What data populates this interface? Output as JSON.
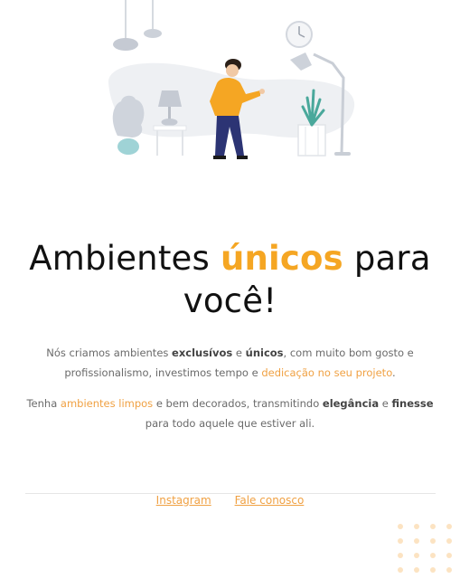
{
  "hero": {
    "title_part1": "Ambientes ",
    "title_accent": "únicos",
    "title_part2": " para",
    "title_line2": "você!"
  },
  "paragraph1": {
    "t1": "Nós criamos ambientes ",
    "b1": "exclusívos",
    "t2": " e ",
    "b2": "únicos",
    "t3": ", com muito bom gosto e profissionalismo, investimos tempo e ",
    "accent1": "dedicação no seu projeto",
    "t4": "."
  },
  "paragraph2": {
    "t1": "Tenha ",
    "accent1": "ambientes limpos",
    "t2": " e bem decorados, transmitindo ",
    "b1": "elegância",
    "t3": " e ",
    "b2": "finesse",
    "t4": " para todo aquele que estiver ali."
  },
  "footer": {
    "instagram_label": "Instagram",
    "contact_label": "Fale conosco"
  },
  "colors": {
    "accent": "#F5A623",
    "link": "#F0A143",
    "text": "#6a6a6a",
    "heading": "#111111",
    "dots": "#FCE3C2"
  },
  "icons": [
    "hanging-lamp-icon",
    "wall-clock-icon",
    "floor-lamp-icon",
    "person-figure",
    "potted-plant-icon",
    "table-lamp-icon",
    "side-table-icon"
  ]
}
